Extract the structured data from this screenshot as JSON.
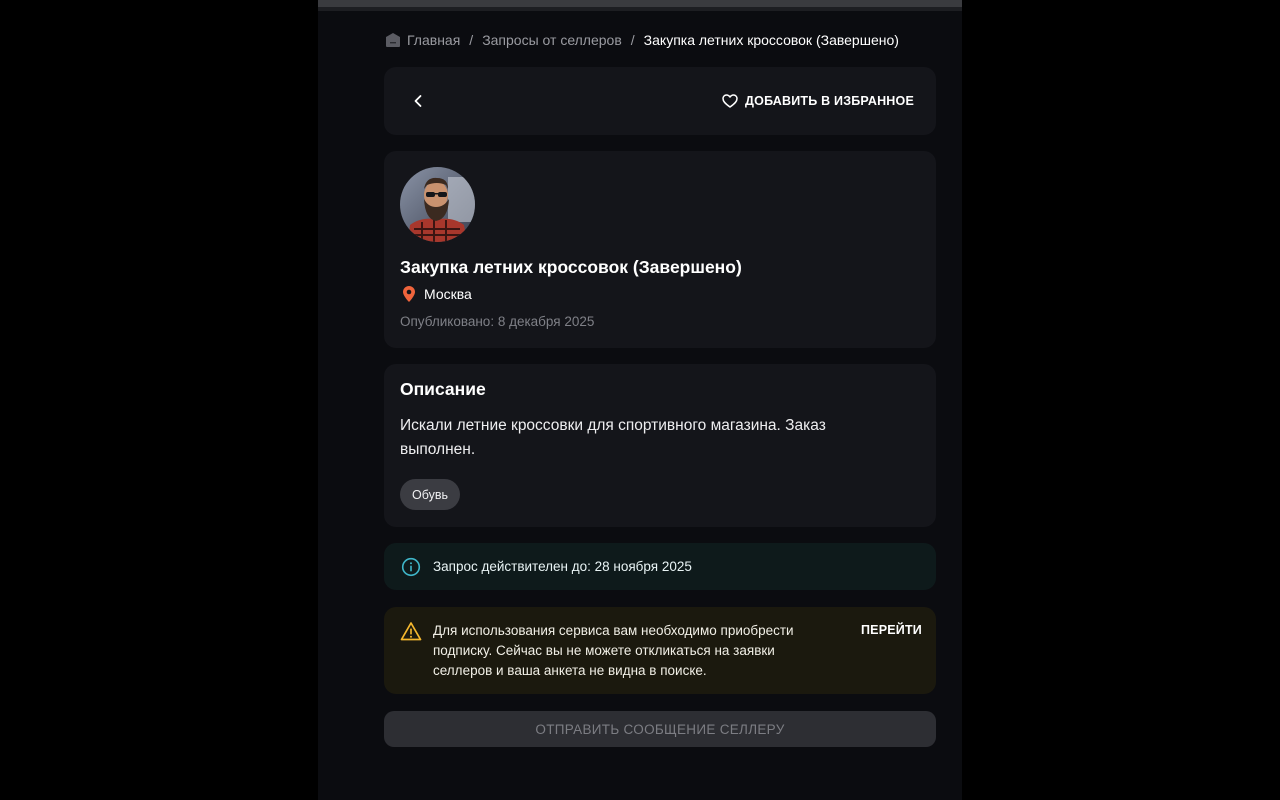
{
  "breadcrumb": {
    "home": "Главная",
    "section": "Запросы от селлеров",
    "current": "Закупка летних кроссовок (Завершено)",
    "separator": "/"
  },
  "nav": {
    "favorite_label": "ДОБАВИТЬ В ИЗБРАННОЕ"
  },
  "request": {
    "title": "Закупка летних кроссовок (Завершено)",
    "city": "Москва",
    "published": "Опубликовано: 8 декабря 2025"
  },
  "description": {
    "heading": "Описание",
    "text": "Искали летние кроссовки для спортивного магазина. Заказ выполнен.",
    "tags": [
      "Обувь"
    ]
  },
  "validity_notice": {
    "text": "Запрос действителен до: 28 ноября 2025"
  },
  "subscription_warning": {
    "text": "Для использования сервиса вам необходимо приобрести подписку. Сейчас вы не можете откликаться на заявки селлеров и ваша анкета не видна в поиске.",
    "link": "ПЕРЕЙТИ"
  },
  "actions": {
    "send_message": "ОТПРАВИТЬ СООБЩЕНИЕ СЕЛЛЕРУ"
  },
  "colors": {
    "background": "#0b0c10",
    "card": "#14151a",
    "pin": "#f0643c",
    "info_accent": "#3fb6c9",
    "warning_accent": "#f5b82e"
  },
  "icons": {
    "home": "home-icon",
    "back": "chevron-left-icon",
    "favorite": "heart-icon",
    "location": "location-pin-icon",
    "info": "info-icon",
    "warning": "warning-icon"
  }
}
